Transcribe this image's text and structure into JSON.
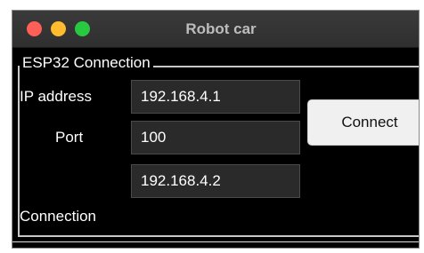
{
  "window": {
    "title": "Robot car"
  },
  "group": {
    "title": "ESP32 Connection"
  },
  "fields": {
    "ip_label": "IP address",
    "ip_value": "192.168.4.1",
    "port_label": "Port",
    "port_value": "100",
    "local_ip_value": "192.168.4.2",
    "connection_label": "Connection"
  },
  "buttons": {
    "connect_label": "Connect"
  },
  "colors": {
    "close": "#fe5f57",
    "minimize": "#febc2e",
    "zoom": "#28c840",
    "window_bg": "#000000",
    "field_bg": "#2a2a2a"
  }
}
